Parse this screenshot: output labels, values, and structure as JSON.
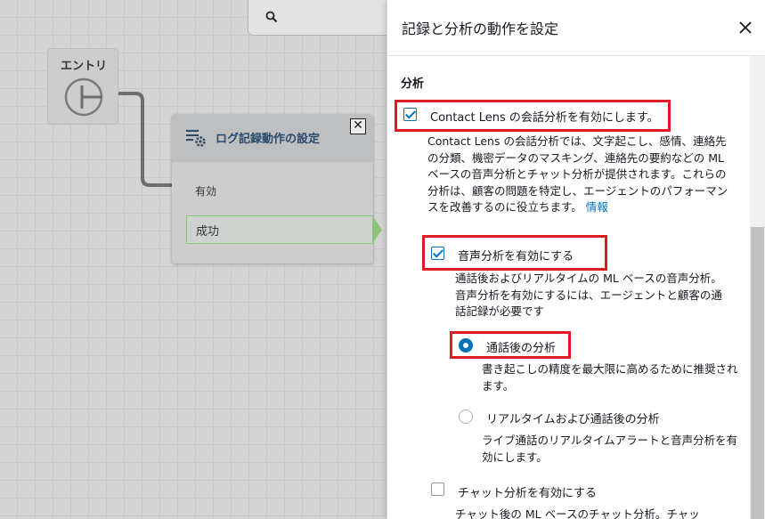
{
  "canvas": {
    "entry_title": "エントリ",
    "log_node": {
      "title": "ログ記録動作の設定",
      "close_glyph": "✕",
      "input_label": "有効",
      "branch_label": "成功"
    }
  },
  "panel": {
    "title": "記録と分析の動作を設定",
    "section_heading": "分析",
    "contact_lens": {
      "label": "Contact Lens の会話分析を有効にします。",
      "checked": true,
      "description": "Contact Lens の会話分析では、文字起こし、感情、連絡先の分類、機密データのマスキング、連絡先の要約などの ML ベースの音声分析とチャット分析が提供されます。これらの分析は、顧客の問題を特定し、エージェントのパフォーマンスを改善するのに役立ちます。",
      "info_link": "情報"
    },
    "speech": {
      "label": "音声分析を有効にする",
      "checked": true,
      "description": "通話後およびリアルタイムの ML ベースの音声分析。音声分析を有効にするには、エージェントと顧客の通話記録が必要です"
    },
    "post_call": {
      "label": "通話後の分析",
      "selected": true,
      "description": "書き起こしの精度を最大限に高めるために推奨されます。"
    },
    "realtime": {
      "label": "リアルタイムおよび通話後の分析",
      "selected": false,
      "description": "ライブ通話のリアルタイムアラートと音声分析を有効にします。"
    },
    "chat": {
      "label": "チャット分析を有効にする",
      "checked": false,
      "description": "チャット後の ML ベースのチャット分析。チャッ"
    }
  },
  "colors": {
    "accent": "#0073bb",
    "highlight": "#e01b24",
    "branch_success": "#8dc47a"
  },
  "icons": [
    "search-icon",
    "start-icon",
    "log-settings-icon",
    "close-icon"
  ]
}
